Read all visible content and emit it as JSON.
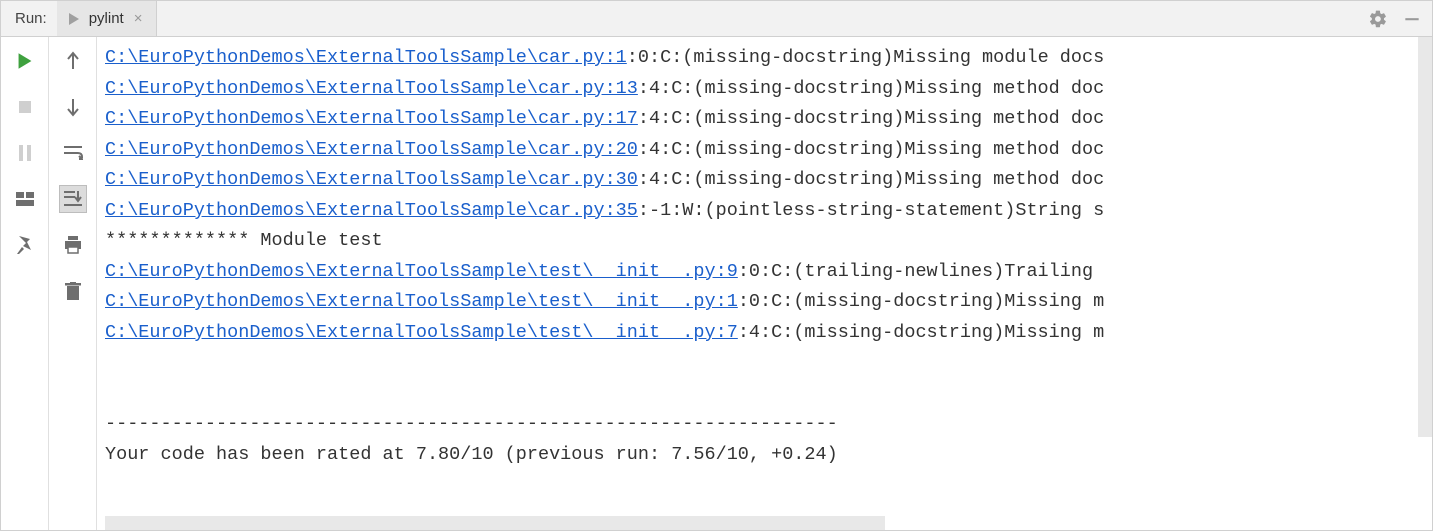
{
  "header": {
    "run_label": "Run:",
    "tab_label": "pylint",
    "tab_close_glyph": "×"
  },
  "toolbar_left": {
    "run": "run",
    "stop": "stop",
    "pause": "pause",
    "layout": "layout",
    "pin": "pin"
  },
  "toolbar_right": {
    "up": "up",
    "down": "down",
    "wrap": "wrap",
    "scroll_end": "scroll_end",
    "print": "print",
    "trash": "trash"
  },
  "header_actions": {
    "settings": "settings",
    "minimize": "minimize"
  },
  "console": {
    "lines": [
      {
        "link": "C:\\EuroPythonDemos\\ExternalToolsSample\\car.py:1",
        "rest": ":0:C:(missing-docstring)Missing module docs"
      },
      {
        "link": "C:\\EuroPythonDemos\\ExternalToolsSample\\car.py:13",
        "rest": ":4:C:(missing-docstring)Missing method doc"
      },
      {
        "link": "C:\\EuroPythonDemos\\ExternalToolsSample\\car.py:17",
        "rest": ":4:C:(missing-docstring)Missing method doc"
      },
      {
        "link": "C:\\EuroPythonDemos\\ExternalToolsSample\\car.py:20",
        "rest": ":4:C:(missing-docstring)Missing method doc"
      },
      {
        "link": "C:\\EuroPythonDemos\\ExternalToolsSample\\car.py:30",
        "rest": ":4:C:(missing-docstring)Missing method doc"
      },
      {
        "link": "C:\\EuroPythonDemos\\ExternalToolsSample\\car.py:35",
        "rest": ":-1:W:(pointless-string-statement)String s"
      },
      {
        "text": "************* Module test"
      },
      {
        "link": "C:\\EuroPythonDemos\\ExternalToolsSample\\test\\__init__.py:9",
        "rest": ":0:C:(trailing-newlines)Trailing "
      },
      {
        "link": "C:\\EuroPythonDemos\\ExternalToolsSample\\test\\__init__.py:1",
        "rest": ":0:C:(missing-docstring)Missing m"
      },
      {
        "link": "C:\\EuroPythonDemos\\ExternalToolsSample\\test\\__init__.py:7",
        "rest": ":4:C:(missing-docstring)Missing m"
      },
      {
        "text": ""
      },
      {
        "text": ""
      },
      {
        "text": "------------------------------------------------------------------"
      },
      {
        "text": "Your code has been rated at 7.80/10 (previous run: 7.56/10, +0.24)"
      }
    ]
  }
}
